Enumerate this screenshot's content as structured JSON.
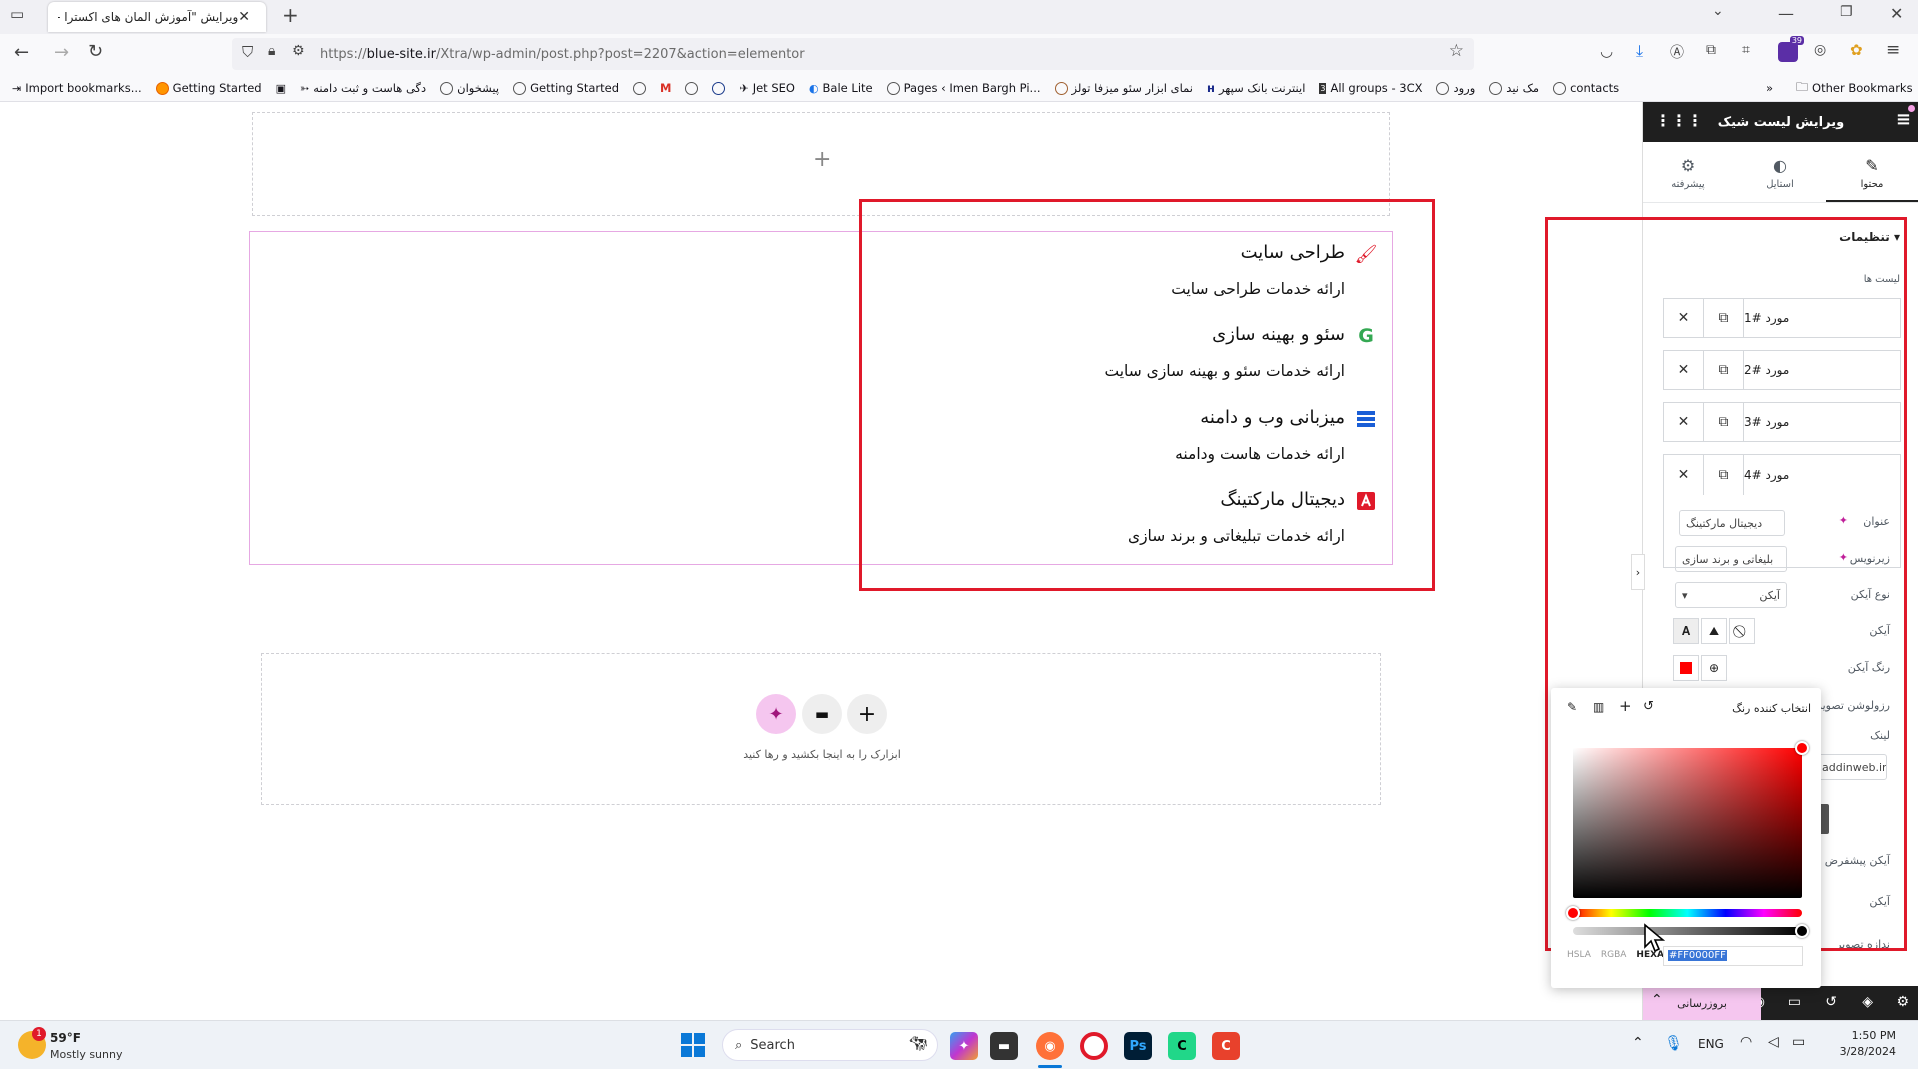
{
  "browser": {
    "tab_title": "ویرایش \"آموزش المان های اکسترا - ...",
    "url_prefix": "https://",
    "url_domain": "blue-site.ir",
    "url_path": "/Xtra/wp-admin/post.php?post=2207&action=elementor",
    "extension_badge": "39",
    "bookmarks": [
      "Import bookmarks...",
      "Getting Started",
      "دگی هاست و ثبت دامنه",
      "پیشخوان",
      "Getting Started",
      "Jet SEO",
      "Bale Lite",
      "Pages ‹ Imen Bargh Pi...",
      "نمای ابزار سئو میزفا تولز",
      "اینترنت بانک سپهر",
      "All groups - 3CX",
      "ورود",
      "مک نید",
      "contacts"
    ],
    "other_bookmarks": "Other Bookmarks"
  },
  "canvas": {
    "list_items": [
      {
        "title": "طراحی سایت",
        "desc": "ارائه خدمات طراحی سایت",
        "icon": "brush-icon",
        "color": "#e0192a"
      },
      {
        "title": "سئو و بهینه سازی",
        "desc": "ارائه خدمات سئو و بهینه سازی سایت",
        "icon": "google-g-icon",
        "color": "#34a853"
      },
      {
        "title": "میزبانی وب و دامنه",
        "desc": "ارائه خدمات هاست ودامنه",
        "icon": "server-icon",
        "color": "#1a5ed6"
      },
      {
        "title": "دیجیتال مارکتینگ",
        "desc": "ارائه خدمات تبلیغاتی و برند سازی",
        "icon": "adobe-icon",
        "color": "#e0192a"
      }
    ],
    "drop_hint": "ابزارک را به اینجا بکشید و رها کنید"
  },
  "panel": {
    "title": "ویرایش لیست شیک",
    "tabs": [
      {
        "label": "محتوا",
        "icon": "pencil-icon"
      },
      {
        "label": "استایل",
        "icon": "contrast-icon"
      },
      {
        "label": "پیشرفته",
        "icon": "gear-icon"
      }
    ],
    "section_title": "تنظیمات",
    "list_label": "لیست ها",
    "items": [
      "مورد #1",
      "مورد #2",
      "مورد #3",
      "مورد #4"
    ],
    "fields": {
      "title_label": "عنوان",
      "title_value": "دیجیتال مارکتینگ",
      "subtitle_label": "زیرنویس",
      "subtitle_value": "بلیغاتی و برند سازی",
      "icon_type_label": "نوع آیکن",
      "icon_type_value": "آیکن",
      "icon_label": "آیکن",
      "icon_color_label": "رنگ آیکن",
      "image_res_label": "رزولوشن تصویر",
      "link_label": "لینک",
      "link_value": "addinweb.ir",
      "prefix_icon_label": "آیکن پیشفرض",
      "icon2_label": "آیکن",
      "extra_label": "ندازه تصویر"
    },
    "publish_label": "بروزرسانی"
  },
  "picker": {
    "title": "انتخاب کننده رنگ",
    "formats": [
      "HSLA",
      "RGBA",
      "HEXA"
    ],
    "active_format": "HEXA",
    "hex_value": "#FF0000FF",
    "selected_color": "#ff0000"
  },
  "taskbar": {
    "weather_temp": "59°F",
    "weather_desc": "Mostly sunny",
    "weather_badge": "1",
    "search_placeholder": "Search",
    "lang": "ENG",
    "time": "1:50 PM",
    "date": "3/28/2024"
  }
}
